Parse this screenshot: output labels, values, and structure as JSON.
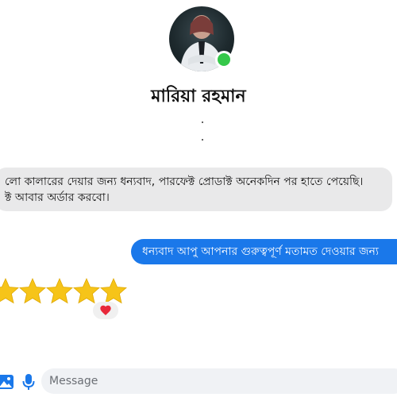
{
  "contact": {
    "name": "মারিয়া রহমান",
    "status": "online"
  },
  "messages": [
    {
      "direction": "incoming",
      "lines": [
        "লো কালারের দেয়ার জন্য ধন্যবাদ, পারফেক্ট প্রোডাক্ট অনেকদিন পর হাতে পেয়েছি।",
        "ক্ট আবার অর্ডার করবো।"
      ]
    },
    {
      "direction": "outgoing",
      "text": "ধন্যবাদ আপু আপনার গুরুত্বপূর্ণ মতামত দেওয়ার জন্য"
    },
    {
      "direction": "incoming",
      "text": "⭐⭐⭐⭐⭐",
      "reaction": "❤"
    }
  ],
  "composer": {
    "placeholder": "Message",
    "icons": [
      "image-icon",
      "microphone-icon"
    ]
  },
  "colors": {
    "outgoing_bubble": "#1a78ea",
    "incoming_bubble": "#e9e9ea",
    "online": "#35c84a",
    "star": "#f6c419"
  }
}
